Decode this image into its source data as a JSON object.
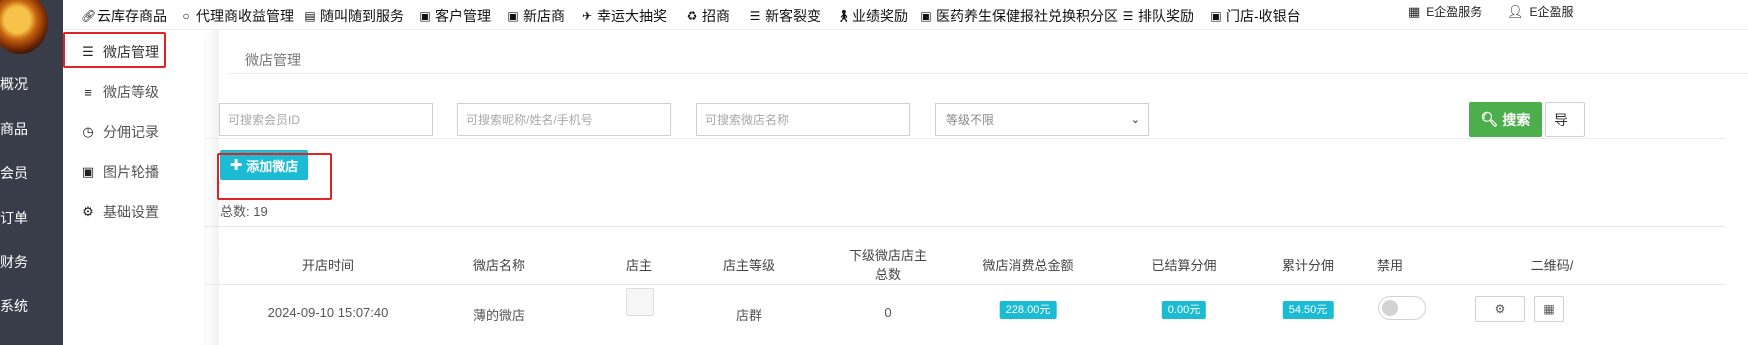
{
  "rail": {
    "items": [
      {
        "label": "概况"
      },
      {
        "label": "商品"
      },
      {
        "label": "会员"
      },
      {
        "label": "订单"
      },
      {
        "label": "财务"
      },
      {
        "label": "系统"
      }
    ]
  },
  "topnav": {
    "items": [
      {
        "label": "云库存商品",
        "icon": "link-icon"
      },
      {
        "label": "代理商收益管理",
        "icon": "circle-icon"
      },
      {
        "label": "随叫随到服务",
        "icon": "card-icon"
      },
      {
        "label": "客户管理",
        "icon": "image-icon"
      },
      {
        "label": "新店商",
        "icon": "image-icon"
      },
      {
        "label": "幸运大抽奖",
        "icon": "plane-icon"
      },
      {
        "label": "招商",
        "icon": "recycle-icon"
      },
      {
        "label": "新客裂变",
        "icon": "menu-icon"
      },
      {
        "label": "业绩奖励",
        "icon": "person-icon"
      },
      {
        "label": "医药养生保健报社兑换积分区",
        "icon": "image-icon"
      },
      {
        "label": "排队奖励",
        "icon": "list-icon"
      },
      {
        "label": "门店-收银台",
        "icon": "camera-icon"
      }
    ],
    "right": [
      {
        "label": "E企盈服务",
        "icon": "grid-icon"
      },
      {
        "label": "E企盈服",
        "icon": "user-icon"
      }
    ]
  },
  "sidebar": {
    "items": [
      {
        "label": "微店管理",
        "icon": "list-icon",
        "active": true
      },
      {
        "label": "微店等级",
        "icon": "align-left-icon"
      },
      {
        "label": "分佣记录",
        "icon": "clock-icon"
      },
      {
        "label": "图片轮播",
        "icon": "image-icon"
      },
      {
        "label": "基础设置",
        "icon": "gears-icon"
      }
    ]
  },
  "main": {
    "breadcrumb": "微店管理",
    "filters": {
      "member_id_placeholder": "可搜索会员ID",
      "nickname_placeholder": "可搜索昵称/姓名/手机号",
      "shop_name_placeholder": "可搜索微店名称",
      "level_select": "等级不限"
    },
    "search_label": "搜索",
    "export_label": "导",
    "add_label": "添加微店",
    "total_label": "总数:",
    "total_value": "19",
    "table": {
      "headers": [
        "开店时间",
        "微店名称",
        "店主",
        "店主等级",
        "下级微店店主",
        "总数",
        "微店消费总金额",
        "已结算分佣",
        "累计分佣",
        "禁用",
        "二维码/"
      ],
      "row": {
        "open_time": "2024-09-10 15:07:40",
        "shop_name": "薄的微店",
        "level": "店群",
        "sub_count": "0",
        "amount": "228.00元",
        "settled": "0.00元",
        "total_commission": "54.50元"
      }
    }
  },
  "colors": {
    "rail_bg": "#393d49",
    "search_green": "#4cae4c",
    "add_cyan": "#1cbbd4",
    "highlight_red": "#e02424"
  }
}
